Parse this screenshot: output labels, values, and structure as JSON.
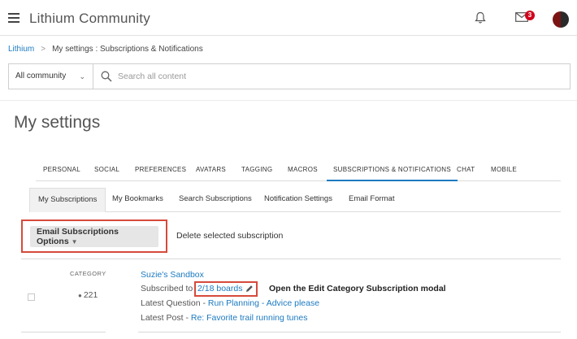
{
  "header": {
    "brand": "Lithium Community",
    "notifications_icon": "bell-icon",
    "messages_icon": "envelope-icon",
    "message_count": "3"
  },
  "breadcrumb": {
    "root": "Lithium",
    "separator": ">",
    "current": "My settings : Subscriptions & Notifications"
  },
  "search": {
    "scope": "All community",
    "placeholder": "Search all content"
  },
  "page": {
    "title": "My settings"
  },
  "tabs": [
    {
      "label": "PERSONAL"
    },
    {
      "label": "SOCIAL"
    },
    {
      "label": "PREFERENCES"
    },
    {
      "label": "AVATARS"
    },
    {
      "label": "TAGGING"
    },
    {
      "label": "MACROS"
    },
    {
      "label": "SUBSCRIPTIONS & NOTIFICATIONS",
      "active": true
    },
    {
      "label": "CHAT"
    },
    {
      "label": "MOBILE"
    }
  ],
  "subtabs": [
    {
      "label": "My Subscriptions",
      "active": true
    },
    {
      "label": "My Bookmarks"
    },
    {
      "label": "Search Subscriptions"
    },
    {
      "label": "Notification Settings"
    },
    {
      "label": "Email Format"
    }
  ],
  "actions": {
    "options_label": "Email Subscriptions Options",
    "delete_label": "Delete selected subscription"
  },
  "subscription": {
    "type_label": "CATEGORY",
    "count": "221",
    "board_name": "Suzie's Sandbox",
    "subscribed_prefix": "Subscribed to",
    "boards_link": "2/18 boards",
    "modal_note": "Open the Edit Category Subscription modal",
    "latest_question_label": "Latest Question -",
    "latest_question": "Run Planning - Advice please",
    "latest_post_label": "Latest Post -",
    "latest_post": "Re: Favorite trail running tunes"
  },
  "colors": {
    "link": "#1c7ac0",
    "highlight": "#d64a3b",
    "badge": "#d0021b"
  }
}
